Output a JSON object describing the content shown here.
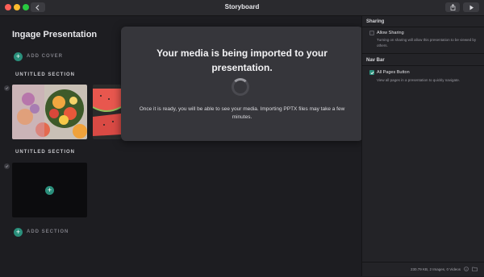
{
  "window": {
    "title": "Storyboard"
  },
  "titlebar": {
    "back_icon": "chevron-left-icon",
    "share_icon": "share-icon",
    "play_icon": "play-icon"
  },
  "presentation": {
    "title": "Ingage Presentation",
    "add_cover_label": "ADD COVER",
    "add_section_label": "ADD SECTION"
  },
  "sections": [
    {
      "label": "UNTITLED SECTION"
    },
    {
      "label": "UNTITLED SECTION"
    }
  ],
  "import_dialog": {
    "title": "Your media is being imported to your presentation.",
    "body": "Once it is ready, you will be able to see your media. Importing PPTX files may take a few minutes."
  },
  "sidebar": {
    "sharing": {
      "heading": "Sharing",
      "option_label": "Allow Sharing",
      "option_checked": false,
      "option_desc": "Turning on sharing will allow this presentation to be viewed by others."
    },
    "navbar": {
      "heading": "Nav Bar",
      "option_label": "All Pages Button",
      "option_checked": true,
      "option_desc": "View all pages in a presentation to quickly navigate."
    },
    "footer_status": "230.79 KB, 2 Images, 0 Videos"
  },
  "colors": {
    "accent": "#2a8f7b",
    "background": "#1d1d21",
    "overlay": "#36363b"
  }
}
